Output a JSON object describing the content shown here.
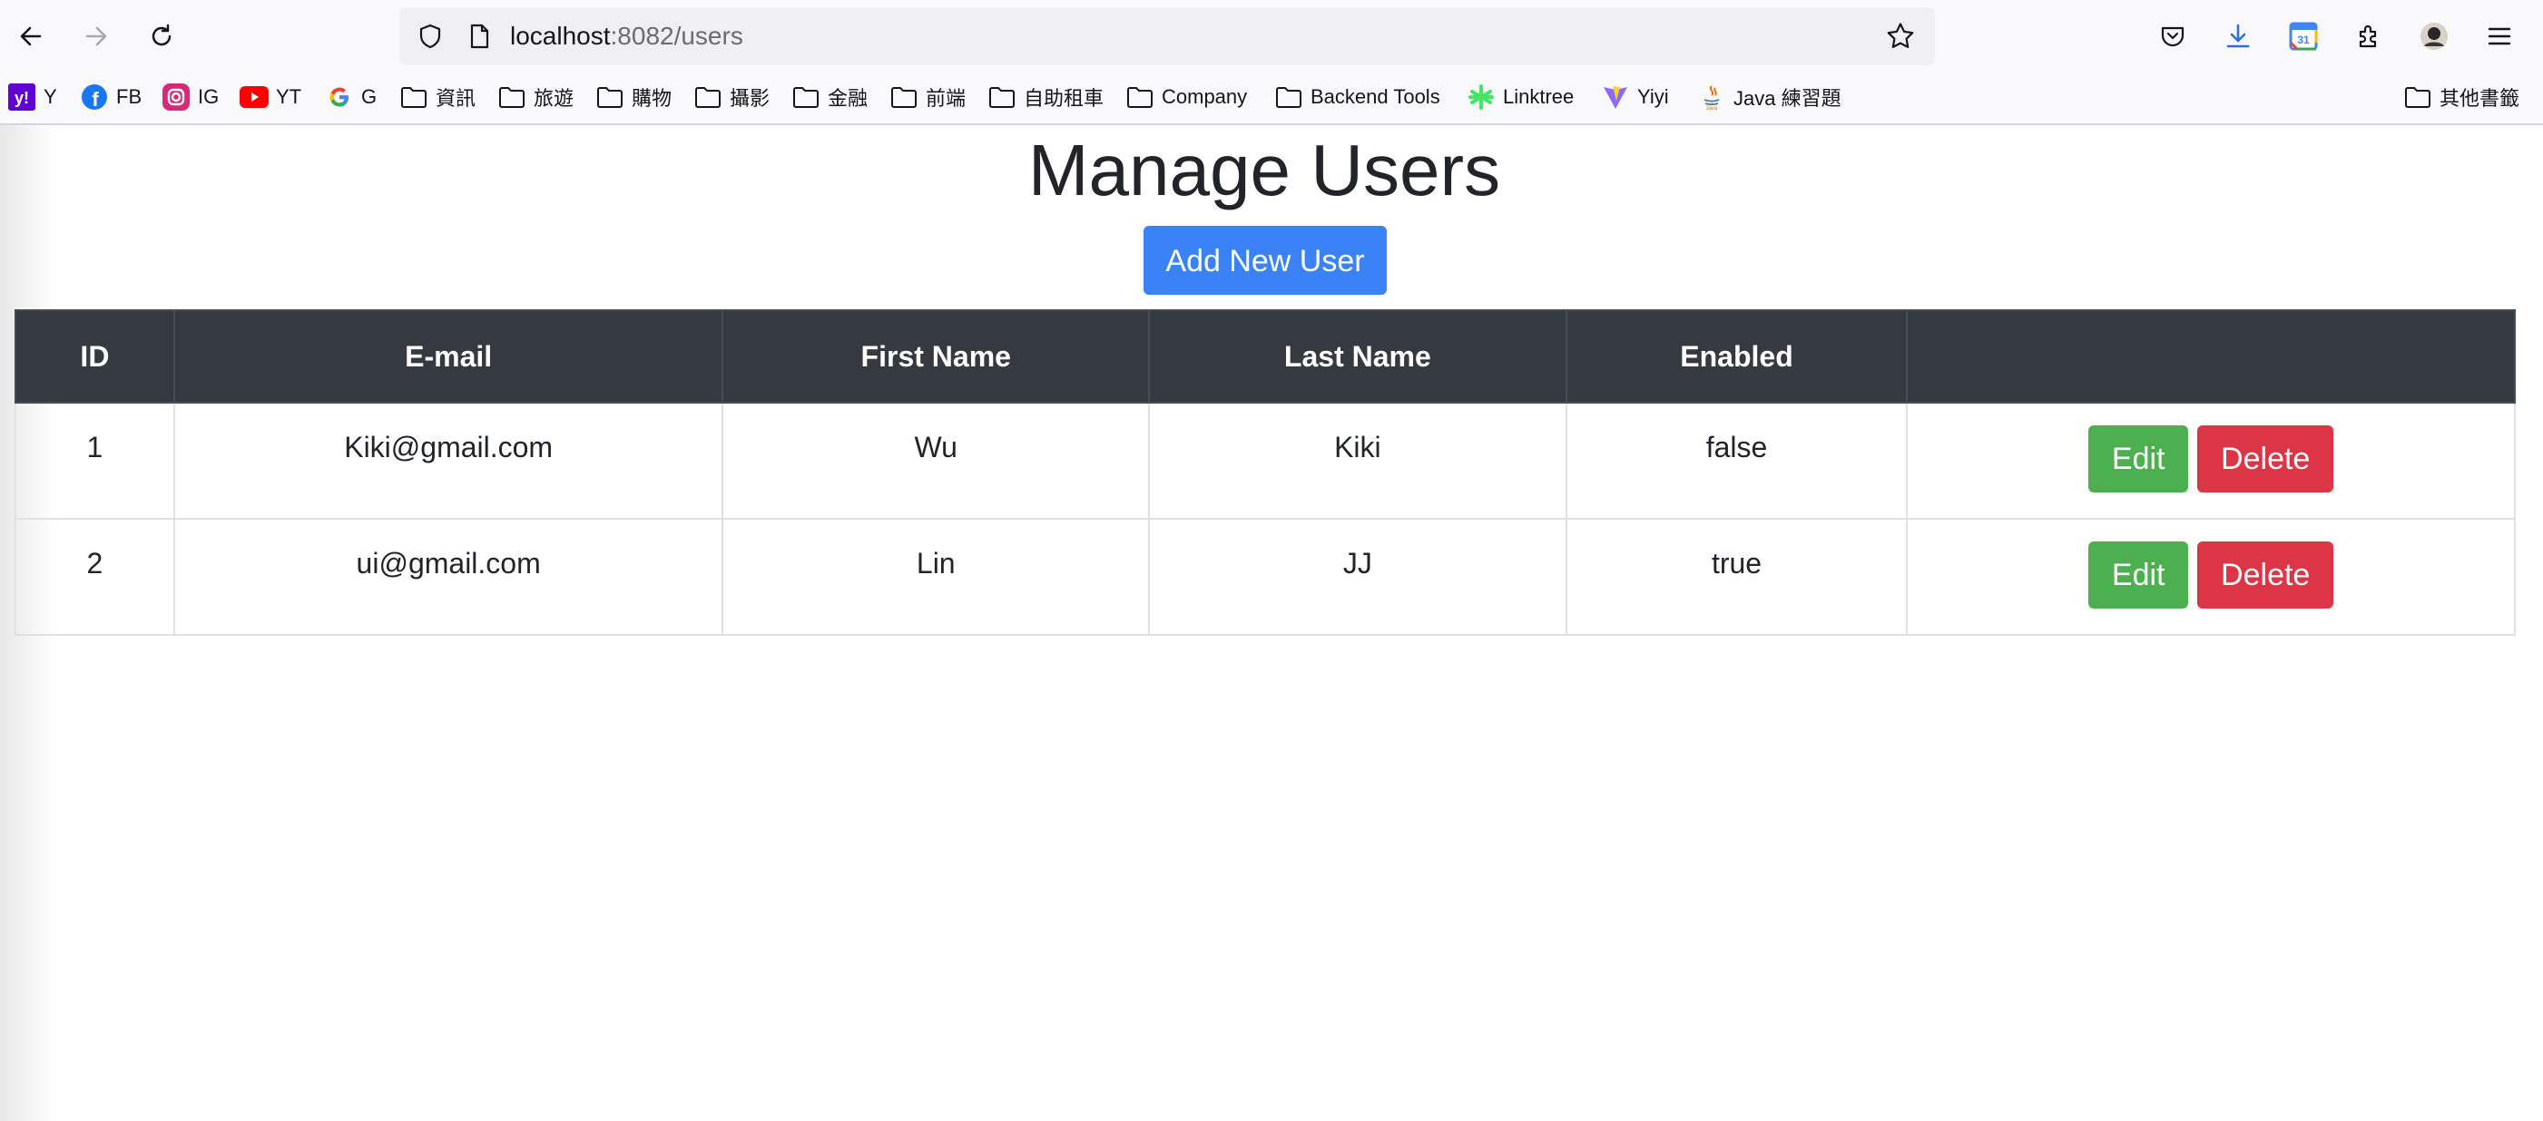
{
  "browser": {
    "url_host": "localhost",
    "url_rest": ":8082/users",
    "bookmarks": [
      {
        "label": "Y",
        "icon": "yahoo-icon"
      },
      {
        "label": "FB",
        "icon": "facebook-icon"
      },
      {
        "label": "IG",
        "icon": "instagram-icon"
      },
      {
        "label": "YT",
        "icon": "youtube-icon"
      },
      {
        "label": "G",
        "icon": "google-icon"
      },
      {
        "label": "資訊",
        "icon": "folder-icon"
      },
      {
        "label": "旅遊",
        "icon": "folder-icon"
      },
      {
        "label": "購物",
        "icon": "folder-icon"
      },
      {
        "label": "攝影",
        "icon": "folder-icon"
      },
      {
        "label": "金融",
        "icon": "folder-icon"
      },
      {
        "label": "前端",
        "icon": "folder-icon"
      },
      {
        "label": "自助租車",
        "icon": "folder-icon"
      },
      {
        "label": "Company",
        "icon": "folder-icon"
      },
      {
        "label": "Backend Tools",
        "icon": "folder-icon"
      },
      {
        "label": "Linktree",
        "icon": "linktree-icon"
      },
      {
        "label": "Yiyi",
        "icon": "vite-icon"
      },
      {
        "label": "Java 練習題",
        "icon": "java-icon"
      }
    ],
    "other_bookmarks": "其他書籤"
  },
  "page": {
    "title": "Manage Users",
    "add_button": "Add New User",
    "accent_color": "#3b82f6",
    "table": {
      "headers": [
        "ID",
        "E-mail",
        "First Name",
        "Last Name",
        "Enabled",
        ""
      ],
      "rows": [
        {
          "id": "1",
          "email": "Kiki@gmail.com",
          "first_name": "Wu",
          "last_name": "Kiki",
          "enabled": "false"
        },
        {
          "id": "2",
          "email": "ui@gmail.com",
          "first_name": "Lin",
          "last_name": "JJ",
          "enabled": "true"
        }
      ],
      "edit_label": "Edit",
      "delete_label": "Delete"
    }
  }
}
